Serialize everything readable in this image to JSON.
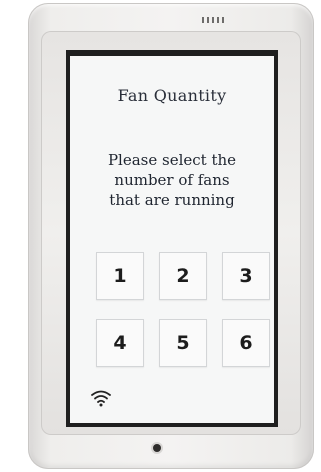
{
  "screen": {
    "title": "Fan Quantity",
    "prompt_lines": [
      "Please select the",
      "number of fans",
      "that are running"
    ]
  },
  "keypad": {
    "keys": [
      "1",
      "2",
      "3",
      "4",
      "5",
      "6"
    ]
  },
  "status": {
    "wifi_icon": "wifi-icon"
  },
  "colors": {
    "screen_background": "#f6f7f7",
    "text": "#1f2530",
    "bezel": "#f0efed",
    "screen_border": "#1f1f1f"
  }
}
